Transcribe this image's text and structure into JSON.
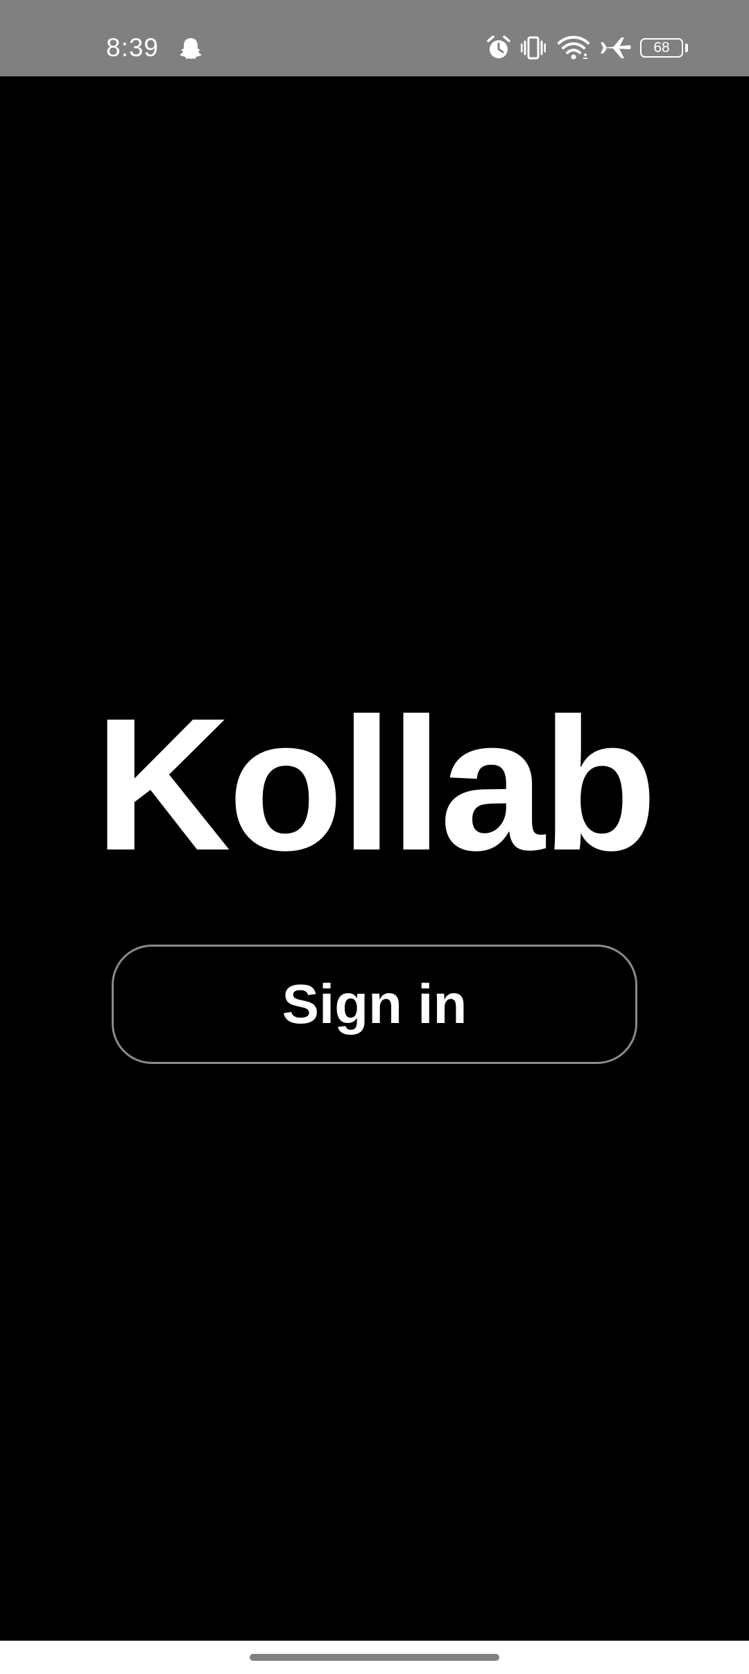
{
  "status_bar": {
    "time": "8:39",
    "notification_icons": [
      "ghost-icon"
    ],
    "system_icons": [
      "alarm-icon",
      "vibrate-icon",
      "wifi-icon",
      "airplane-mode-icon",
      "battery-icon"
    ],
    "battery_level": "68",
    "background_color": "#808080"
  },
  "main": {
    "app_title": "Kollab",
    "signin_label": "Sign in",
    "background_color": "#000000",
    "button_border_color": "#8a8a8a"
  },
  "navigation": {
    "gesture_handle": "home-handle"
  }
}
